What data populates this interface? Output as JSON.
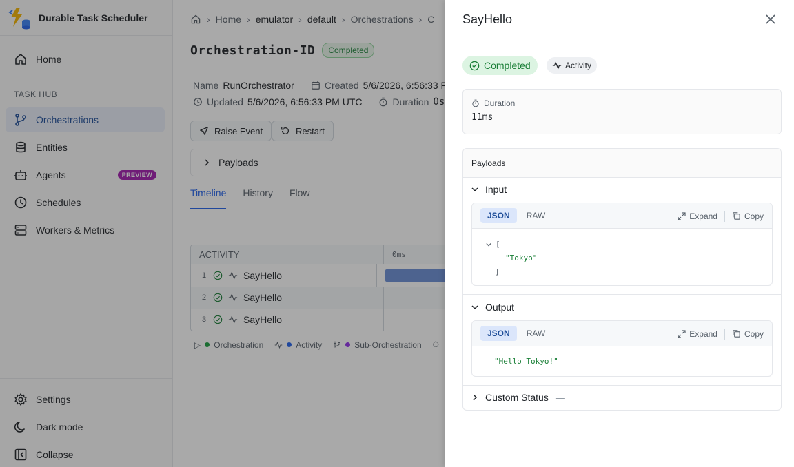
{
  "app": {
    "title": "Durable Task Scheduler"
  },
  "sidebar": {
    "home": "Home",
    "section_label": "TASK HUB",
    "items": [
      {
        "label": "Orchestrations",
        "icon": "branch-icon"
      },
      {
        "label": "Entities",
        "icon": "database-icon"
      },
      {
        "label": "Agents",
        "icon": "robot-icon",
        "badge": "PREVIEW"
      },
      {
        "label": "Schedules",
        "icon": "clock-icon"
      },
      {
        "label": "Workers & Metrics",
        "icon": "server-icon"
      }
    ],
    "bottom": [
      {
        "label": "Settings",
        "icon": "gear-icon"
      },
      {
        "label": "Dark mode",
        "icon": "moon-icon"
      },
      {
        "label": "Collapse",
        "icon": "collapse-icon"
      }
    ]
  },
  "breadcrumb": [
    "Home",
    "emulator",
    "default",
    "Orchestrations",
    "C"
  ],
  "orchestration": {
    "id_label": "Orchestration-ID",
    "status": "Completed",
    "name_label": "Name",
    "name": "RunOrchestrator",
    "created_label": "Created",
    "created": "5/6/2026, 6:56:33 P",
    "updated_label": "Updated",
    "updated": "5/6/2026, 6:56:33 PM UTC",
    "duration_label": "Duration",
    "duration": "0s"
  },
  "actions": {
    "raise_event": "Raise Event",
    "restart": "Restart"
  },
  "payloads_label": "Payloads",
  "tabs": [
    "Timeline",
    "History",
    "Flow"
  ],
  "timeline": {
    "col_activity": "ACTIVITY",
    "col_time": "0ms",
    "rows": [
      {
        "num": "1",
        "name": "SayHello"
      },
      {
        "num": "2",
        "name": "SayHello"
      },
      {
        "num": "3",
        "name": "SayHello"
      }
    ],
    "legend": [
      "Orchestration",
      "Activity",
      "Sub-Orchestration"
    ]
  },
  "drawer": {
    "title": "SayHello",
    "status": "Completed",
    "type": "Activity",
    "duration_label": "Duration",
    "duration": "11ms",
    "payloads_label": "Payloads",
    "input_label": "Input",
    "output_label": "Output",
    "custom_status_label": "Custom Status",
    "custom_status_value": "—",
    "json_tab": "JSON",
    "raw_tab": "RAW",
    "expand": "Expand",
    "copy": "Copy",
    "input_open": "[",
    "input_value": "\"Tokyo\"",
    "input_close": "]",
    "output_value": "\"Hello Tokyo!\""
  },
  "colors": {
    "accent": "#2563eb",
    "success": "#1a7f37",
    "activity_dot": "#2563eb",
    "orchestration_dot": "#1a9f3f",
    "sub_orchestration_dot": "#9333ea"
  }
}
